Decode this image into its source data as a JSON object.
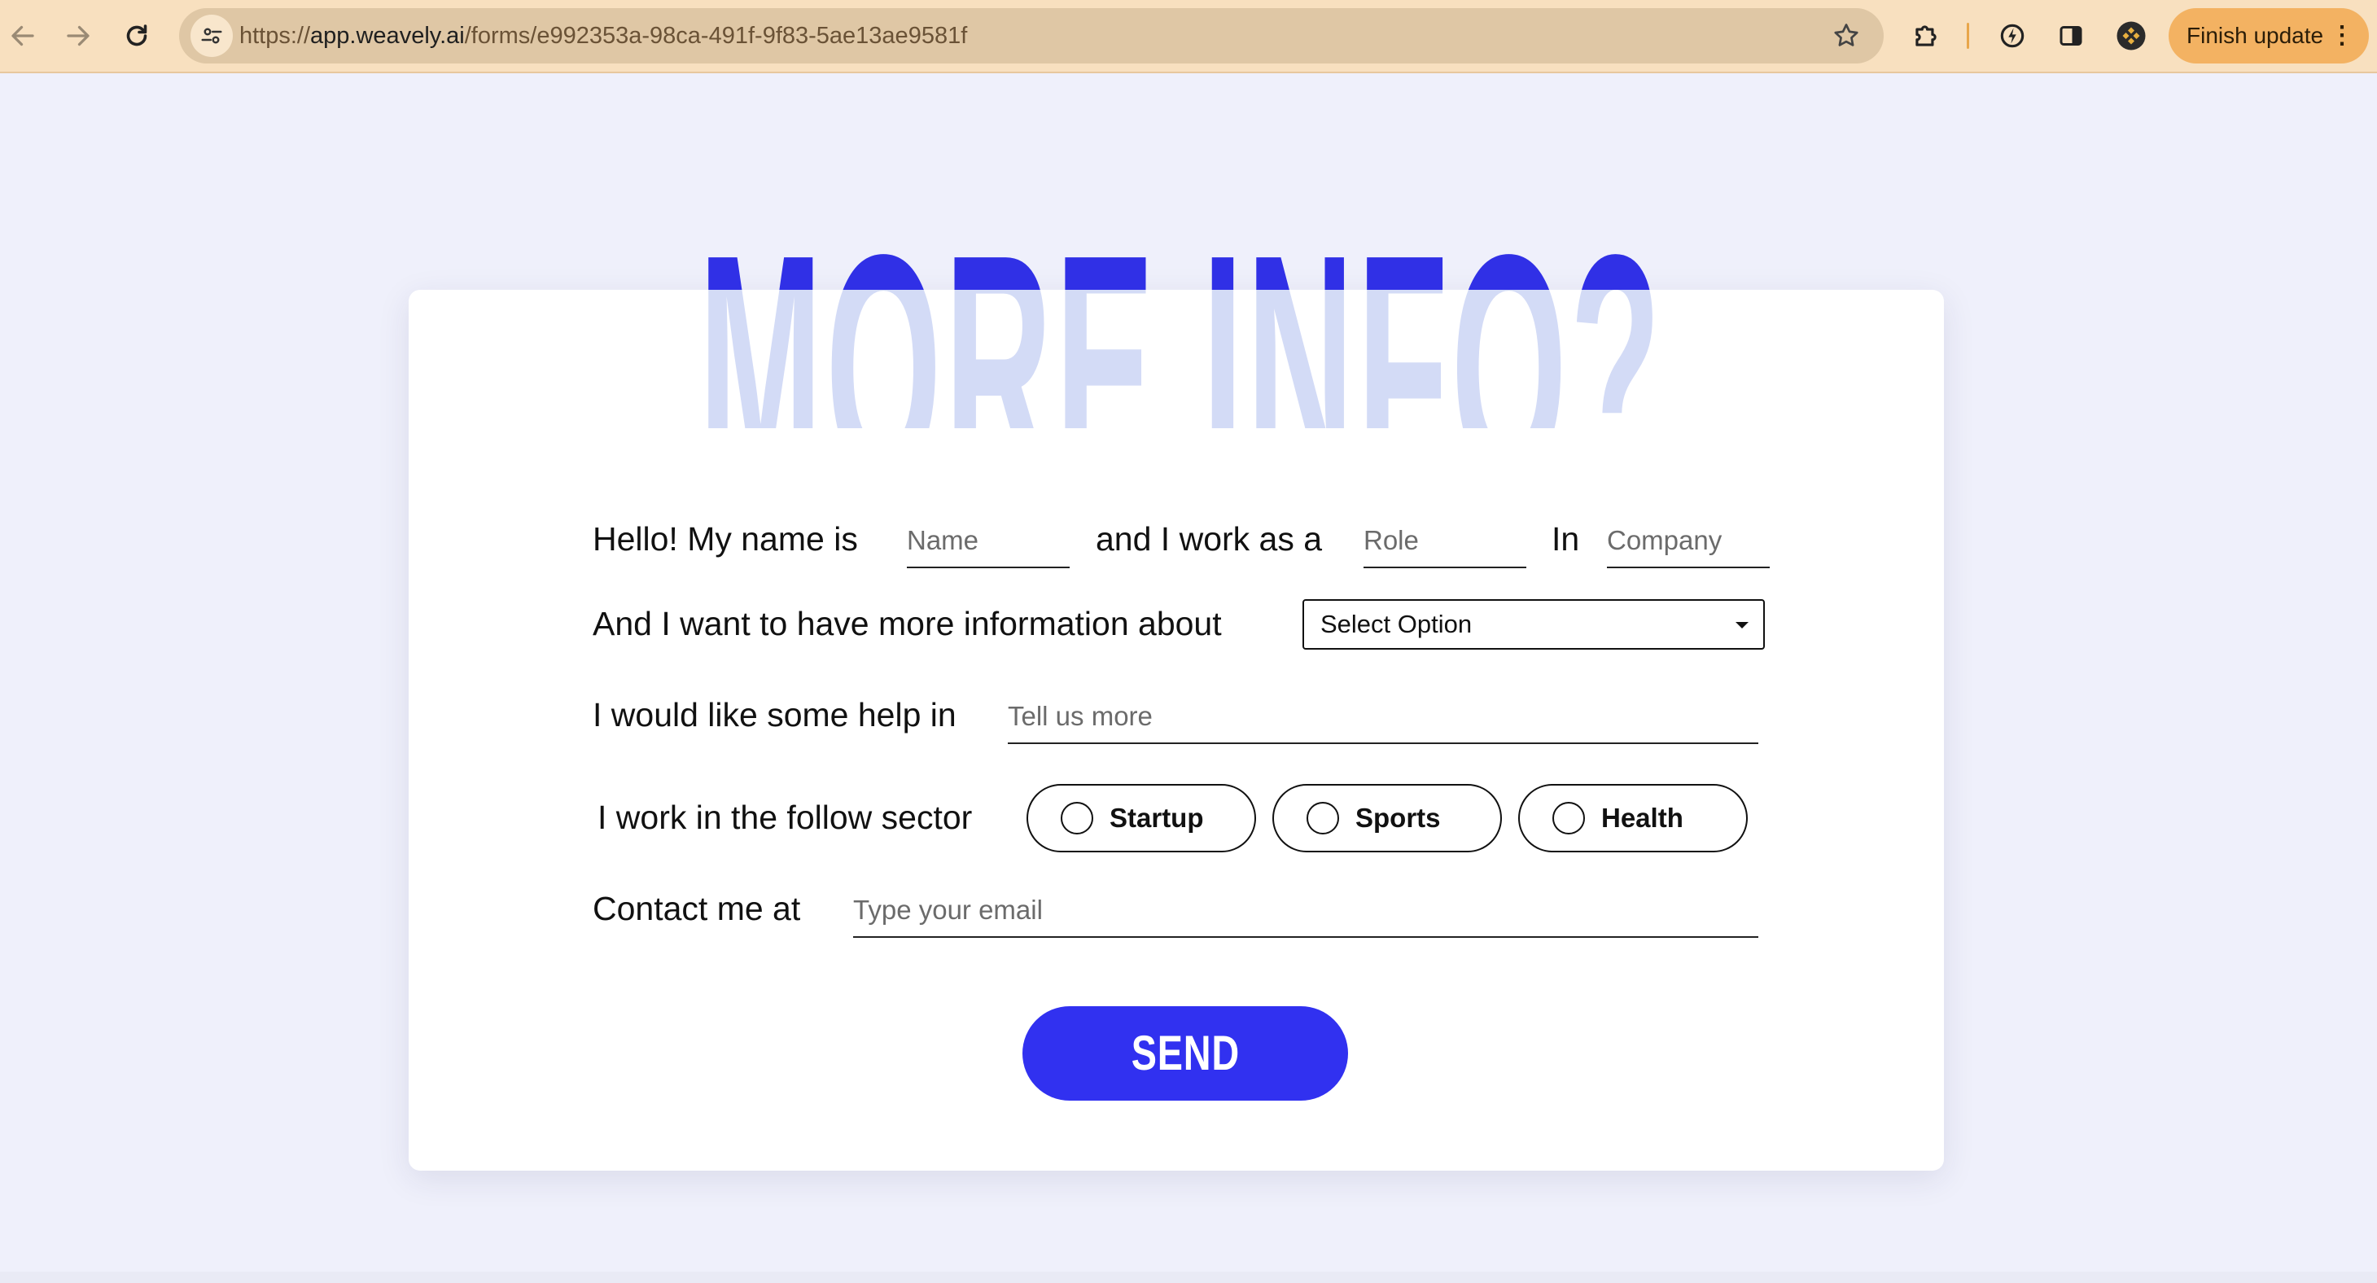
{
  "browser": {
    "url_scheme": "https://",
    "url_host": "app.weavely.ai",
    "url_path": "/forms/e992353a-98ca-491f-9f83-5ae13ae9581f",
    "update_button_label": "Finish update",
    "update_button_dots": "⋮",
    "toolbar_color": "#f8e0bf",
    "accent_color": "#f3b262"
  },
  "form": {
    "hero_title": "MORE INFO?",
    "hero_color_top": "#3030e6",
    "hero_color_bottom": "#d3dbf6",
    "row1": {
      "intro_label": "Hello! My name is",
      "name_placeholder": "Name",
      "role_label": "and I work as a",
      "role_placeholder": "Role",
      "company_label": "In",
      "company_placeholder": "Company"
    },
    "row2": {
      "label": "And I want to have more information about",
      "select_value": "Select Option"
    },
    "row3": {
      "label": "I would like some help in",
      "placeholder": "Tell us more"
    },
    "row4": {
      "label": "I work in the follow sector",
      "options": [
        "Startup",
        "Sports",
        "Health"
      ]
    },
    "row5": {
      "label": "Contact me at",
      "placeholder": "Type your email"
    },
    "send_label": "SEND",
    "send_color": "#3131f0"
  }
}
